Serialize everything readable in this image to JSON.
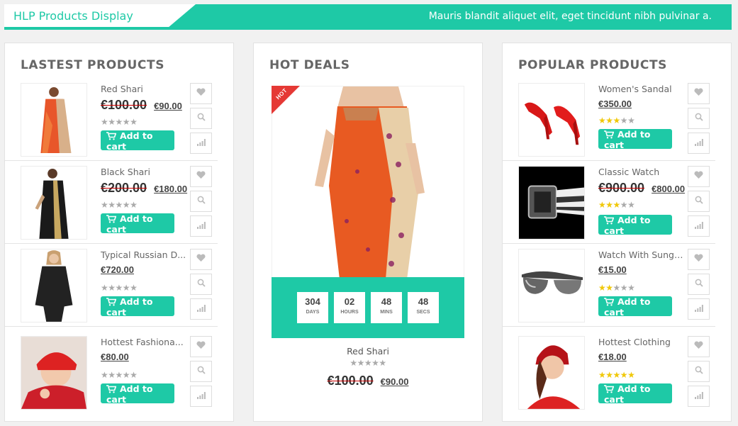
{
  "header": {
    "title": "HLP Products Display",
    "tagline": "Mauris blandit aliquet elit, eget tincidunt nibh pulvinar a."
  },
  "latest": {
    "title": "LASTEST PRODUCTS",
    "products": [
      {
        "name": "Red Shari",
        "old_price": "€100.00",
        "price": "€90.00",
        "rating": 0
      },
      {
        "name": "Black Shari",
        "old_price": "€200.00",
        "price": "€180.00",
        "rating": 0
      },
      {
        "name": "Typical Russian D...",
        "old_price": "",
        "price": "€720.00",
        "rating": 0
      },
      {
        "name": "Hottest Fashiona...",
        "old_price": "",
        "price": "€80.00",
        "rating": 0
      }
    ]
  },
  "hot": {
    "title": "HOT DEALS",
    "badge": "HOT",
    "countdown": [
      {
        "value": "304",
        "label": "DAYS"
      },
      {
        "value": "02",
        "label": "HOURS"
      },
      {
        "value": "48",
        "label": "MINS"
      },
      {
        "value": "48",
        "label": "SECS"
      }
    ],
    "name": "Red Shari",
    "old_price": "€100.00",
    "price": "€90.00",
    "rating": 0
  },
  "popular": {
    "title": "POPULAR PRODUCTS",
    "products": [
      {
        "name": "Women's Sandal",
        "old_price": "",
        "price": "€350.00",
        "rating": 3
      },
      {
        "name": "Classic Watch",
        "old_price": "€900.00",
        "price": "€800.00",
        "rating": 3
      },
      {
        "name": "Watch With Sungl...",
        "old_price": "",
        "price": "€15.00",
        "rating": 2
      },
      {
        "name": "Hottest Clothing",
        "old_price": "",
        "price": "€18.00",
        "rating": 5
      }
    ]
  },
  "labels": {
    "add_to_cart": "Add to cart"
  },
  "colors": {
    "accent": "#1ec9a6",
    "hot_badge": "#e53935",
    "star_on": "#f0c808",
    "star_off": "#aaaaaa"
  }
}
